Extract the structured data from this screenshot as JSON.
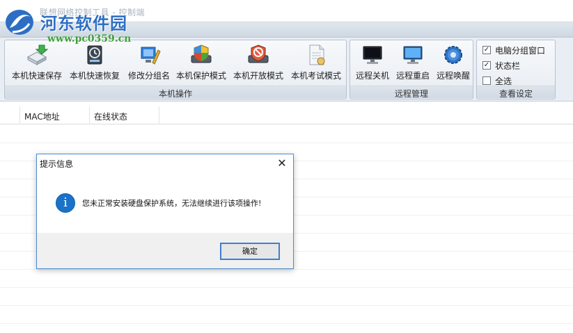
{
  "window": {
    "title": "联想网络控制工具 - 控制端"
  },
  "watermark": {
    "site_name": "河东软件园",
    "url": "www.pc0359.cn"
  },
  "ribbon": {
    "local_group": {
      "label": "本机操作",
      "buttons": [
        {
          "label": "本机快速保存",
          "icon": "disk-save-icon"
        },
        {
          "label": "本机快速恢复",
          "icon": "disk-restore-icon"
        },
        {
          "label": "修改分组名",
          "icon": "edit-group-icon"
        },
        {
          "label": "本机保护模式",
          "icon": "shield-drive-icon"
        },
        {
          "label": "本机开放模式",
          "icon": "unprotected-drive-icon"
        },
        {
          "label": "本机考试模式",
          "icon": "exam-document-icon"
        }
      ]
    },
    "remote_group": {
      "label": "远程管理",
      "buttons": [
        {
          "label": "远程关机",
          "icon": "monitor-off-icon"
        },
        {
          "label": "远程重启",
          "icon": "monitor-restart-icon"
        },
        {
          "label": "远程唤醒",
          "icon": "gear-wake-icon"
        }
      ]
    },
    "view_group": {
      "label": "查看设定",
      "checkboxes": [
        {
          "label": "电脑分组窗口",
          "checked": true
        },
        {
          "label": "状态栏",
          "checked": true
        },
        {
          "label": "全选",
          "checked": false
        }
      ]
    }
  },
  "grid": {
    "columns": [
      "",
      "MAC地址",
      "在线状态"
    ]
  },
  "dialog": {
    "title": "提示信息",
    "close_glyph": "✕",
    "icon": "info-icon",
    "icon_glyph": "i",
    "message": "您未正常安装硬盘保护系统，无法继续进行该项操作!",
    "ok_label": "确定"
  },
  "colors": {
    "accent": "#1a73c9",
    "dialog_border": "#4a8ad2",
    "watermark_blue": "#2d6ec4",
    "watermark_green": "#3fa23a"
  }
}
